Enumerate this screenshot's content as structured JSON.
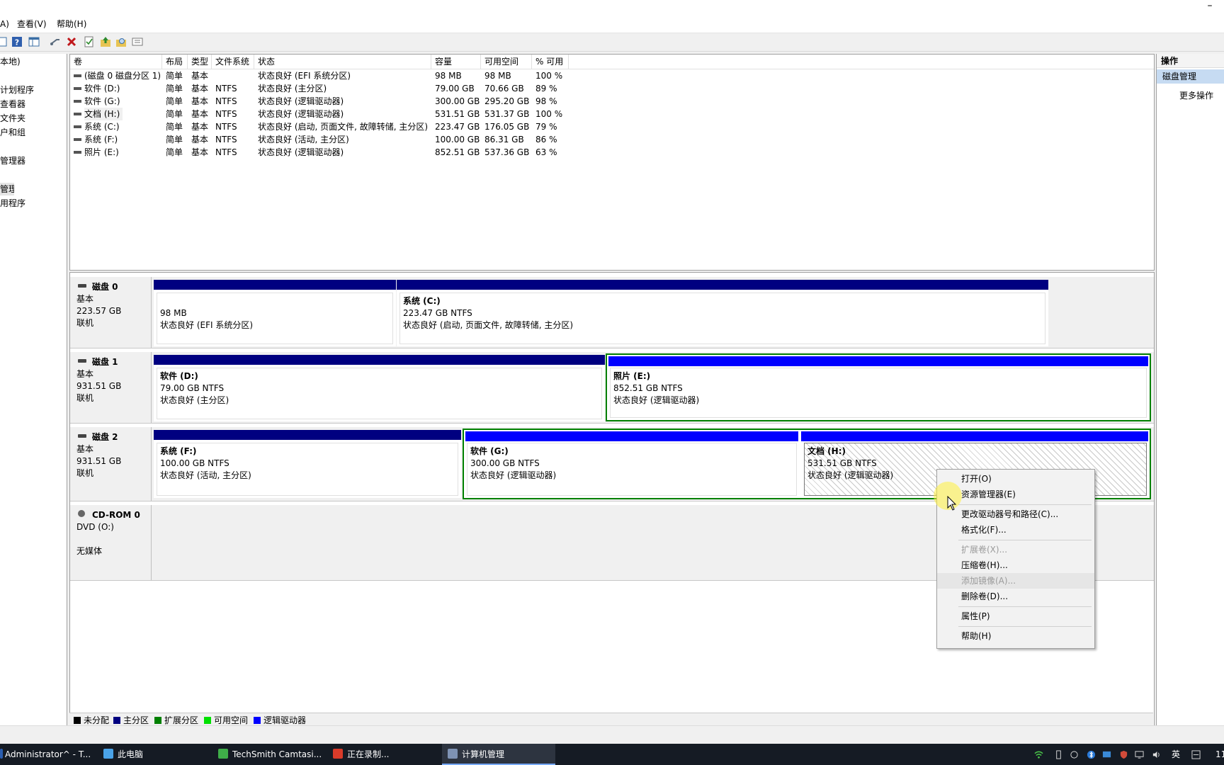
{
  "menu": {
    "partial_action": "A)",
    "view": "查看(V)",
    "help": "帮助(H)"
  },
  "tree": {
    "items": [
      "本地)",
      "",
      "计划程序",
      "查看器",
      "文件夹",
      "户和组",
      "",
      "管理器",
      "",
      "管理",
      "用程序"
    ]
  },
  "volume_list": {
    "columns": [
      "卷",
      "布局",
      "类型",
      "文件系统",
      "状态",
      "容量",
      "可用空间",
      "% 可用"
    ],
    "rows": [
      [
        "(磁盘 0 磁盘分区 1)",
        "简单",
        "基本",
        "",
        "状态良好 (EFI 系统分区)",
        "98 MB",
        "98 MB",
        "100 %"
      ],
      [
        "软件 (D:)",
        "简单",
        "基本",
        "NTFS",
        "状态良好 (主分区)",
        "79.00 GB",
        "70.66 GB",
        "89 %"
      ],
      [
        "软件 (G:)",
        "简单",
        "基本",
        "NTFS",
        "状态良好 (逻辑驱动器)",
        "300.00 GB",
        "295.20 GB",
        "98 %"
      ],
      [
        "文档 (H:)",
        "简单",
        "基本",
        "NTFS",
        "状态良好 (逻辑驱动器)",
        "531.51 GB",
        "531.37 GB",
        "100 %"
      ],
      [
        "系统 (C:)",
        "简单",
        "基本",
        "NTFS",
        "状态良好 (启动, 页面文件, 故障转储, 主分区)",
        "223.47 GB",
        "176.05 GB",
        "79 %"
      ],
      [
        "系统 (F:)",
        "简单",
        "基本",
        "NTFS",
        "状态良好 (活动, 主分区)",
        "100.00 GB",
        "86.31 GB",
        "86 %"
      ],
      [
        "照片 (E:)",
        "简单",
        "基本",
        "NTFS",
        "状态良好 (逻辑驱动器)",
        "852.51 GB",
        "537.36 GB",
        "63 %"
      ]
    ]
  },
  "disks": {
    "d0": {
      "name": "磁盘 0",
      "type": "基本",
      "size": "223.57 GB",
      "status": "联机",
      "p1": {
        "size": "98 MB",
        "status": "状态良好 (EFI 系统分区)"
      },
      "p2": {
        "name": "系统 (C:)",
        "size": "223.47 GB NTFS",
        "status": "状态良好 (启动, 页面文件, 故障转储, 主分区)"
      }
    },
    "d1": {
      "name": "磁盘 1",
      "type": "基本",
      "size": "931.51 GB",
      "status": "联机",
      "p1": {
        "name": "软件 (D:)",
        "size": "79.00 GB NTFS",
        "status": "状态良好 (主分区)"
      },
      "p2": {
        "name": "照片 (E:)",
        "size": "852.51 GB NTFS",
        "status": "状态良好 (逻辑驱动器)"
      }
    },
    "d2": {
      "name": "磁盘 2",
      "type": "基本",
      "size": "931.51 GB",
      "status": "联机",
      "p1": {
        "name": "系统 (F:)",
        "size": "100.00 GB NTFS",
        "status": "状态良好 (活动, 主分区)"
      },
      "p2": {
        "name": "软件 (G:)",
        "size": "300.00 GB NTFS",
        "status": "状态良好 (逻辑驱动器)"
      },
      "p3": {
        "name": "文档 (H:)",
        "size": "531.51 GB NTFS",
        "status": "状态良好 (逻辑驱动器)"
      }
    },
    "cd": {
      "name": "CD-ROM 0",
      "type": "DVD (O:)",
      "status": "无媒体"
    }
  },
  "legend": [
    "未分配",
    "主分区",
    "扩展分区",
    "可用空间",
    "逻辑驱动器"
  ],
  "legend_colors": [
    "#000000",
    "#000080",
    "#008000",
    "#00e000",
    "#0000ff"
  ],
  "actions": {
    "title": "操作",
    "selected": "磁盘管理",
    "more": "更多操作"
  },
  "context_menu": {
    "open": "打开(O)",
    "explorer": "资源管理器(E)",
    "change_letter": "更改驱动器号和路径(C)...",
    "format": "格式化(F)...",
    "extend": "扩展卷(X)...",
    "shrink": "压缩卷(H)...",
    "mirror": "添加镜像(A)...",
    "delete": "删除卷(D)...",
    "properties": "属性(P)",
    "help": "帮助(H)"
  },
  "taskbar": {
    "t1": "Administrator^ - T...",
    "t2": "此电脑",
    "t3": "TechSmith Camtasi...",
    "t4": "正在录制...",
    "t5": "计算机管理",
    "ime": "英",
    "clock": "11"
  },
  "colors": {
    "primary": "#000080",
    "logical": "#0000ff",
    "extended": "#008000",
    "free": "#00e000"
  }
}
